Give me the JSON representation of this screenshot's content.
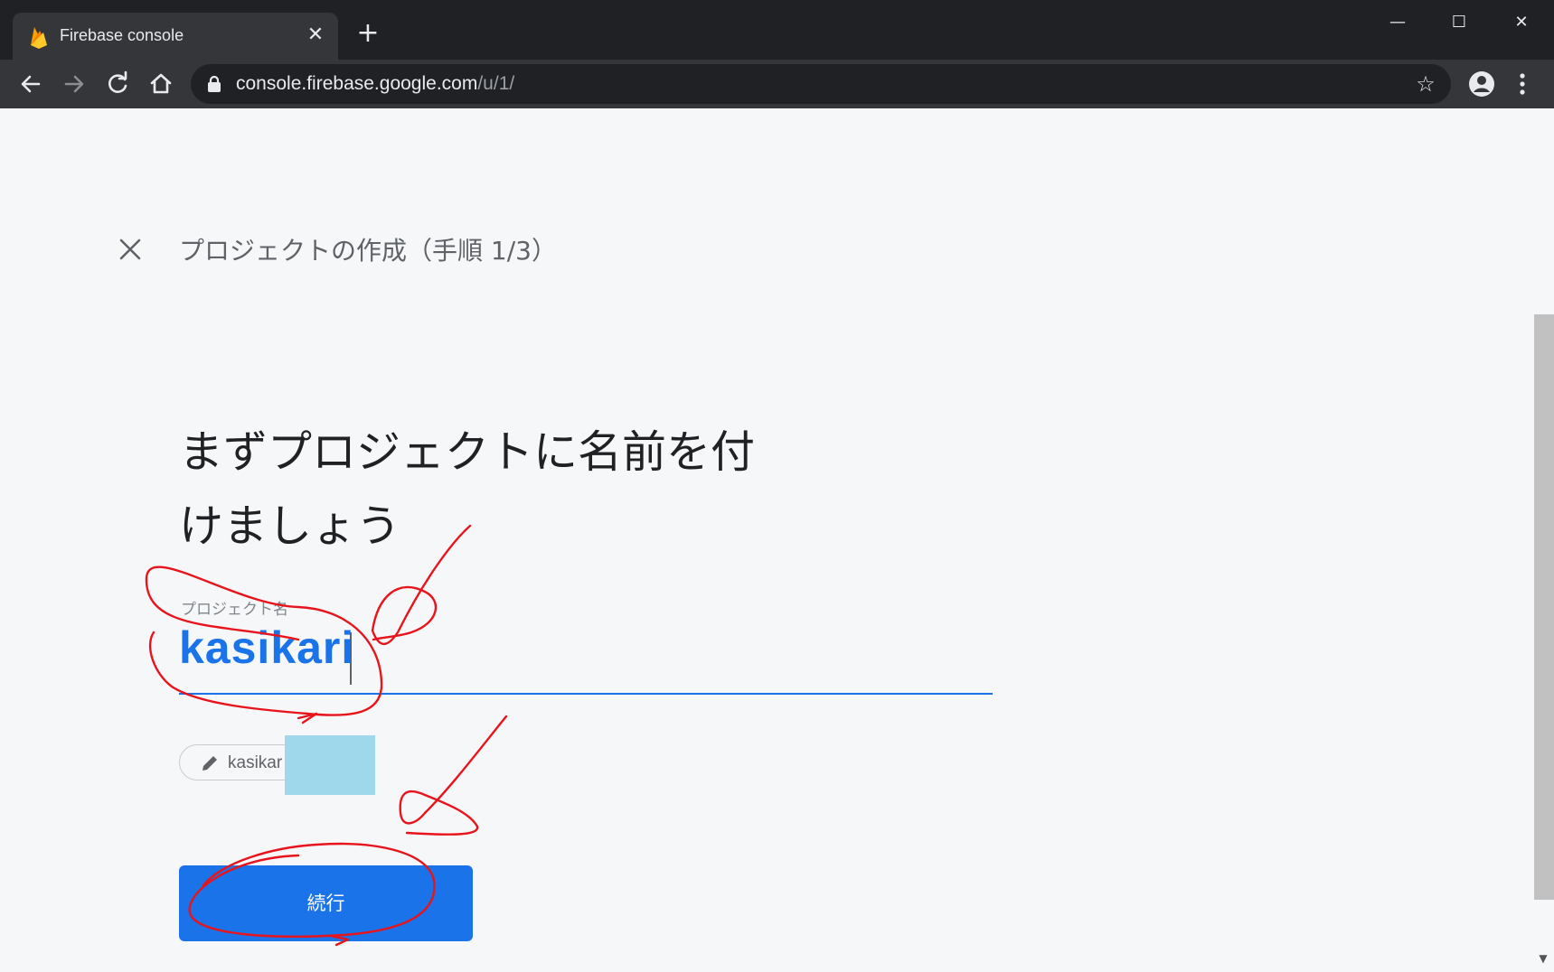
{
  "browser": {
    "tab_title": "Firebase console",
    "tab_close": "✕",
    "new_tab": "+",
    "window_controls": {
      "minimize": "—",
      "maximize": "☐",
      "close": "✕"
    },
    "url_host": "console.firebase.google.com",
    "url_path": "/u/1/",
    "star": "☆"
  },
  "page": {
    "step_title": "プロジェクトの作成（手順 1/3）",
    "heading_line1": "まずプロジェクトに名前を付",
    "heading_line2": "けましょう",
    "field_label": "プロジェクト名",
    "field_value": "kasikari",
    "project_id_chip": "kasikar",
    "continue_label": "続行"
  },
  "colors": {
    "accent": "#1a73e8",
    "annotation": "#e8141c",
    "redaction": "#9fd8ea"
  },
  "icons": [
    "firebase-icon",
    "close-icon",
    "plus-icon",
    "back-icon",
    "forward-icon",
    "reload-icon",
    "home-icon",
    "lock-icon",
    "star-icon",
    "account-icon",
    "menu-icon",
    "pencil-icon"
  ]
}
